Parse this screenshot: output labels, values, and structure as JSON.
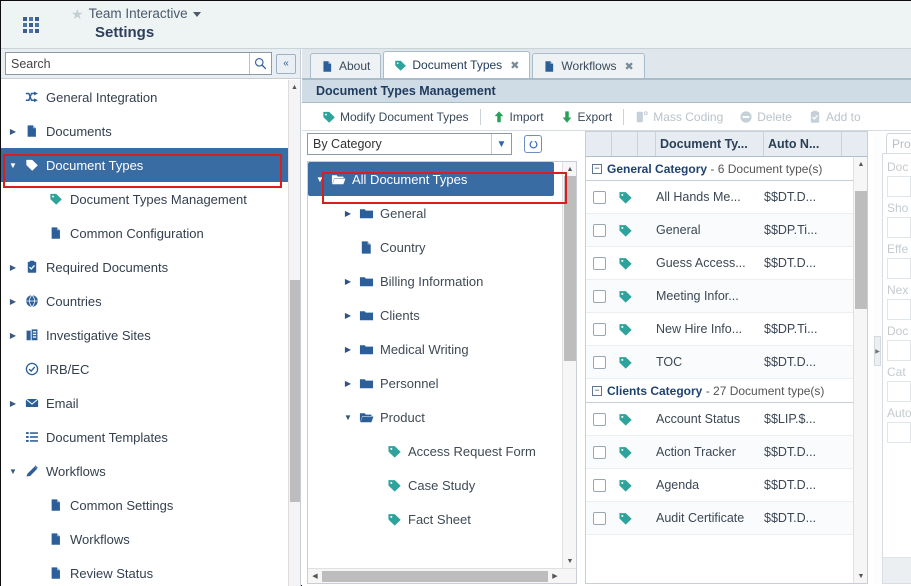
{
  "header": {
    "waffle_icon": "apps-grid-icon",
    "star_icon": "star-icon",
    "team_name": "Team Interactive",
    "caret_icon": "chevron-down-icon",
    "page_title": "Settings"
  },
  "sidebar": {
    "search": {
      "placeholder": "Search",
      "value": "",
      "search_icon": "search-icon",
      "collapse_icon": "double-chevron-left-icon"
    },
    "items": [
      {
        "label": "General Integration",
        "icon": "shuffle-icon",
        "indent": 0,
        "arrow": "",
        "selected": false
      },
      {
        "label": "Documents",
        "icon": "document-icon",
        "indent": 0,
        "arrow": "right",
        "selected": false
      },
      {
        "label": "Document Types",
        "icon": "tag-icon",
        "indent": 0,
        "arrow": "down",
        "selected": true
      },
      {
        "label": "Document Types Management",
        "icon": "tag-icon",
        "indent": 1,
        "arrow": "",
        "selected": false
      },
      {
        "label": "Common Configuration",
        "icon": "document-icon",
        "indent": 1,
        "arrow": "",
        "selected": false
      },
      {
        "label": "Required Documents",
        "icon": "clipboard-check-icon",
        "indent": 0,
        "arrow": "right",
        "selected": false
      },
      {
        "label": "Countries",
        "icon": "globe-icon",
        "indent": 0,
        "arrow": "right",
        "selected": false
      },
      {
        "label": "Investigative Sites",
        "icon": "building-icon",
        "indent": 0,
        "arrow": "right",
        "selected": false
      },
      {
        "label": "IRB/EC",
        "icon": "check-circle-icon",
        "indent": 0,
        "arrow": "",
        "selected": false
      },
      {
        "label": "Email",
        "icon": "envelope-icon",
        "indent": 0,
        "arrow": "right",
        "selected": false
      },
      {
        "label": "Document Templates",
        "icon": "list-icon",
        "indent": 0,
        "arrow": "",
        "selected": false
      },
      {
        "label": "Workflows",
        "icon": "pencil-icon",
        "indent": 0,
        "arrow": "down",
        "selected": false
      },
      {
        "label": "Common Settings",
        "icon": "document-icon",
        "indent": 1,
        "arrow": "",
        "selected": false
      },
      {
        "label": "Workflows",
        "icon": "document-icon",
        "indent": 1,
        "arrow": "",
        "selected": false
      },
      {
        "label": "Review Status",
        "icon": "document-icon",
        "indent": 1,
        "arrow": "",
        "selected": false
      }
    ]
  },
  "tabs": [
    {
      "label": "About",
      "icon": "document-icon",
      "active": false,
      "closable": false
    },
    {
      "label": "Document Types",
      "icon": "tag-icon",
      "active": true,
      "closable": true
    },
    {
      "label": "Workflows",
      "icon": "document-icon",
      "active": false,
      "closable": true
    }
  ],
  "panel": {
    "title": "Document Types Management",
    "toolbar": [
      {
        "label": "Modify Document Types",
        "icon": "tag-icon",
        "disabled": false
      },
      {
        "label": "Import",
        "icon": "arrow-up-icon",
        "disabled": false
      },
      {
        "label": "Export",
        "icon": "arrow-down-icon",
        "disabled": false
      },
      {
        "label": "Mass Coding",
        "icon": "mass-coding-icon",
        "disabled": true
      },
      {
        "label": "Delete",
        "icon": "delete-circle-icon",
        "disabled": true
      },
      {
        "label": "Add to",
        "icon": "clipboard-check-icon",
        "disabled": true
      }
    ]
  },
  "tree": {
    "filter_value": "By Category",
    "filter_options": [
      "By Category"
    ],
    "refresh_icon": "refresh-icon",
    "nodes": [
      {
        "label": "All Document Types",
        "icon": "folder-open-icon",
        "arrow": "down",
        "indent": 0,
        "selected": true
      },
      {
        "label": "General",
        "icon": "folder-icon",
        "arrow": "right",
        "indent": 1,
        "selected": false
      },
      {
        "label": "Country",
        "icon": "document-icon",
        "arrow": "",
        "indent": 1,
        "selected": false
      },
      {
        "label": "Billing Information",
        "icon": "folder-icon",
        "arrow": "right",
        "indent": 1,
        "selected": false
      },
      {
        "label": "Clients",
        "icon": "folder-icon",
        "arrow": "right",
        "indent": 1,
        "selected": false
      },
      {
        "label": "Medical Writing",
        "icon": "folder-icon",
        "arrow": "right",
        "indent": 1,
        "selected": false
      },
      {
        "label": "Personnel",
        "icon": "folder-icon",
        "arrow": "right",
        "indent": 1,
        "selected": false
      },
      {
        "label": "Product",
        "icon": "folder-open-icon",
        "arrow": "down",
        "indent": 1,
        "selected": false
      },
      {
        "label": "Access Request Form",
        "icon": "tag-icon",
        "arrow": "",
        "indent": 2,
        "selected": false
      },
      {
        "label": "Case Study",
        "icon": "tag-icon",
        "arrow": "",
        "indent": 2,
        "selected": false
      },
      {
        "label": "Fact Sheet",
        "icon": "tag-icon",
        "arrow": "",
        "indent": 2,
        "selected": false
      }
    ]
  },
  "grid": {
    "columns": [
      "",
      "",
      "",
      "Document Ty...",
      "Auto N...",
      ""
    ],
    "groups": [
      {
        "title": "General Category",
        "subtitle": "- 6 Document type(s)",
        "collapse_icon": "minus-box-icon",
        "rows": [
          {
            "checked": false,
            "icon": "tag-icon",
            "name": "All Hands Me...",
            "auto": "$$DT.D..."
          },
          {
            "checked": false,
            "icon": "tag-icon",
            "name": "General",
            "auto": "$$DP.Ti..."
          },
          {
            "checked": false,
            "icon": "tag-icon",
            "name": "Guess Access...",
            "auto": "$$DT.D..."
          },
          {
            "checked": false,
            "icon": "tag-icon",
            "name": "Meeting Infor...",
            "auto": ""
          },
          {
            "checked": false,
            "icon": "tag-icon",
            "name": "New Hire Info...",
            "auto": "$$DP.Ti..."
          },
          {
            "checked": false,
            "icon": "tag-icon",
            "name": "TOC",
            "auto": "$$DT.D..."
          }
        ]
      },
      {
        "title": "Clients Category",
        "subtitle": "- 27 Document type(s)",
        "collapse_icon": "minus-box-icon",
        "rows": [
          {
            "checked": false,
            "icon": "tag-icon",
            "name": "Account Status",
            "auto": "$$LIP.$..."
          },
          {
            "checked": false,
            "icon": "tag-icon",
            "name": "Action Tracker",
            "auto": "$$DT.D..."
          },
          {
            "checked": false,
            "icon": "tag-icon",
            "name": "Agenda",
            "auto": "$$DT.D..."
          },
          {
            "checked": false,
            "icon": "tag-icon",
            "name": "Audit Certificate",
            "auto": "$$DT.D..."
          }
        ]
      }
    ]
  },
  "properties": {
    "tab_label": "Pro",
    "fields": [
      {
        "label": "Doc"
      },
      {
        "label": "Sho"
      },
      {
        "label": "Effe"
      },
      {
        "label": "Nex"
      },
      {
        "label": "Doc"
      },
      {
        "label": "Cat"
      },
      {
        "label": "Auto"
      }
    ]
  },
  "colors": {
    "accent": "#3a6ca4",
    "highlight_border": "#d81f1f",
    "header_bg": "#eef3f4",
    "panel_title_bg": "#cfdbe5",
    "tag_teal": "#2ea39b",
    "folder_blue": "#2c5f99"
  }
}
